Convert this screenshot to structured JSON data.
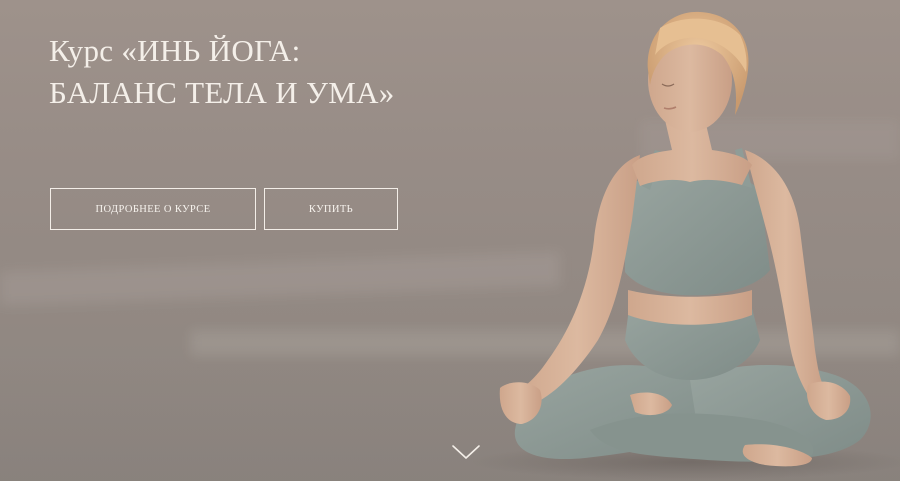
{
  "hero": {
    "title_line1": "Курс «ИНЬ ЙОГА:",
    "title_line2": "БАЛАНС ТЕЛА И УМА»"
  },
  "buttons": {
    "details_label": "ПОДРОБНЕЕ О КУРСЕ",
    "buy_label": "КУПИТЬ"
  },
  "icons": {
    "scroll": "chevron-down-icon"
  },
  "colors": {
    "background": "#978c86",
    "text": "#f4efe9",
    "outfit": "#8e9b96",
    "skin": "#d9b59c",
    "hair": "#e2b98f"
  }
}
